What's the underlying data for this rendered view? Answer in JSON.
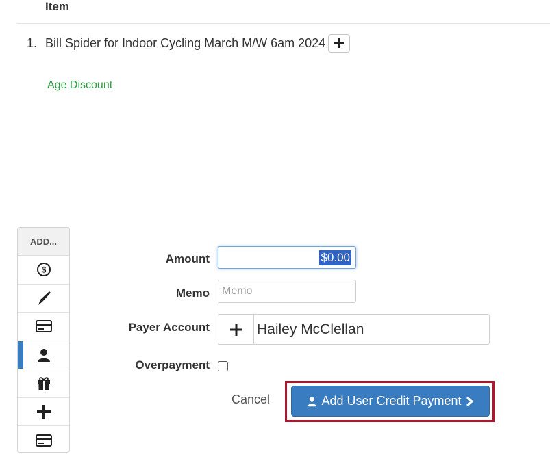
{
  "table": {
    "header": "Item",
    "items": [
      {
        "number": "1.",
        "name": "Bill Spider for Indoor Cycling March M/W 6am 2024"
      }
    ],
    "discount": "Age Discount"
  },
  "sidebar": {
    "header": "ADD...",
    "items": [
      {
        "icon": "dollar-icon"
      },
      {
        "icon": "pen-icon"
      },
      {
        "icon": "credit-card-icon"
      },
      {
        "icon": "user-icon",
        "active": true
      },
      {
        "icon": "gift-icon"
      },
      {
        "icon": "plus-icon"
      },
      {
        "icon": "credit-card-icon"
      }
    ]
  },
  "form": {
    "amount_label": "Amount",
    "amount_value": "$0.00",
    "memo_label": "Memo",
    "memo_placeholder": "Memo",
    "payer_label": "Payer Account",
    "payer_value": "Hailey McClellan",
    "overpayment_label": "Overpayment",
    "cancel_label": "Cancel",
    "submit_label": "Add User Credit Payment"
  },
  "colors": {
    "accent": "#3a7cc0",
    "discount": "#2e9e44",
    "highlight": "#b3152e"
  }
}
